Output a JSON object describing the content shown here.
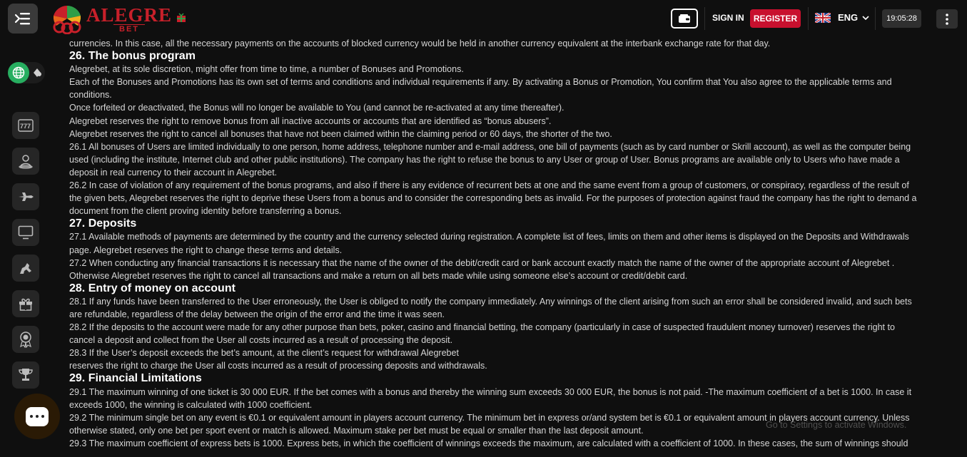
{
  "header": {
    "logo_word": "ALEGRE",
    "logo_sub": "BET",
    "sign_in_label": "SIGN IN",
    "register_label": "REGISTER",
    "language": "ENG",
    "time": "19:05:28"
  },
  "sidebar": {
    "icons": [
      "slots-icon",
      "live-dealer-icon",
      "aviator-icon",
      "tv-games-icon",
      "virtual-sports-icon",
      "gift-icon",
      "award-icon",
      "trophy-icon"
    ]
  },
  "content": {
    "lines": [
      {
        "type": "p",
        "text": "currencies. In this case, all the necessary payments on the accounts of blocked currency would be held in another currency equivalent at the interbank exchange rate for that day."
      },
      {
        "type": "h",
        "text": "26. The bonus program"
      },
      {
        "type": "p",
        "text": "Alegrebet, at its sole discretion, might offer from time to time, a number of Bonuses and Promotions."
      },
      {
        "type": "p",
        "text": "Each of the Bonuses and Promotions has its own set of terms and conditions and individual requirements if any. By activating a Bonus or Promotion, You confirm that You also agree to the applicable terms and"
      },
      {
        "type": "p",
        "text": "conditions."
      },
      {
        "type": "p",
        "text": "Once forfeited or deactivated, the Bonus will no longer be available to You (and cannot be re-activated at any time thereafter)."
      },
      {
        "type": "p",
        "text": "Alegrebet reserves the right to remove bonus from all inactive accounts or accounts that are identified as “bonus abusers”."
      },
      {
        "type": "p",
        "text": "Alegrebet reserves the right to cancel all bonuses that have not been claimed within the claiming period or 60 days, the shorter of the two."
      },
      {
        "type": "p",
        "text": "26.1 All bonuses of Users are limited individually to one person, home address, telephone number and e-mail address, one bill of payments (such as by card number or Skrill account), as well as the computer being"
      },
      {
        "type": "p",
        "text": "used (including the institute, Internet club and other public institutions). The company has the right to refuse the bonus to any User or group of User. Bonus programs are available only to Users who have made a"
      },
      {
        "type": "p",
        "text": "deposit in real currency to their account in Alegrebet."
      },
      {
        "type": "p",
        "text": "26.2 In case of violation of any requirement of the bonus programs, and also if there is any evidence of recurrent bets at one and the same event from a group of customers, or conspiracy, regardless of the result of"
      },
      {
        "type": "p",
        "text": "the given bets, Alegrebet reserves the right to deprive these Users from a bonus and to consider the corresponding bets as invalid. For the purposes of protection against fraud the company has the right to demand a"
      },
      {
        "type": "p",
        "text": "document from the client proving identity before transferring a bonus."
      },
      {
        "type": "h",
        "text": "27. Deposits"
      },
      {
        "type": "p",
        "text": "27.1 Available methods of payments are determined by the country and the currency selected during registration. A complete list of fees, limits on them and other items is displayed on the Deposits and Withdrawals"
      },
      {
        "type": "p",
        "text": "page. Alegrebet reserves the right to change these terms and details."
      },
      {
        "type": "p",
        "text": "27.2 When conducting any financial transactions it is necessary that the name of the owner of the debit/credit card or bank account exactly match the name of the owner of the appropriate account of Alegrebet ."
      },
      {
        "type": "p",
        "text": "Otherwise Alegrebet reserves the right to cancel all transactions and make a return on all bets made while using someone else’s account or credit/debit card."
      },
      {
        "type": "h",
        "text": "28. Entry of money on account"
      },
      {
        "type": "p",
        "text": "28.1 If any funds have been transferred to the User erroneously, the User is obliged to notify the company immediately. Any winnings of the client arising from such an error shall be considered invalid, and such bets"
      },
      {
        "type": "p",
        "text": "are refundable, regardless of the delay between the origin of the error and the time it was seen."
      },
      {
        "type": "p",
        "text": "28.2 If the deposits to the account were made for any other purpose than bets, poker, casino and financial betting, the company (particularly in case of suspected fraudulent money turnover) reserves the right to"
      },
      {
        "type": "p",
        "text": "cancel a deposit and collect from the User all costs incurred as a result of processing the deposit."
      },
      {
        "type": "p",
        "text": "28.3 If the User’s deposit exceeds the bet’s amount, at the client’s request for withdrawal Alegrebet"
      },
      {
        "type": "p",
        "text": "reserves the right to charge the User all costs incurred as a result of processing deposits and withdrawals."
      },
      {
        "type": "h",
        "text": "29. Financial Limitations"
      },
      {
        "type": "p",
        "text": "29.1 The maximum winning of one ticket is 30 000 EUR. If the bet comes with a bonus and thereby the winning sum exceeds 30 000 EUR, the bonus is not paid. -The maximum coefficient of a bet is 1000. In case it"
      },
      {
        "type": "p",
        "text": "exceeds 1000, the winning is calculated with 1000 coefficient."
      },
      {
        "type": "p",
        "text": "29.2 The minimum single bet on any event is €0.1 or equivalent amount in players account currency. The minimum bet in express or/and system bet is €0.1 or equivalent amount in players account currency. Unless"
      },
      {
        "type": "p",
        "text": "otherwise stated, only one bet per sport event or match is allowed. Maximum stake per bet must be equal or smaller than the last deposit amount."
      },
      {
        "type": "p",
        "text": "29.3 The maximum coefficient of express bets is 1000. Express bets, in which the coefficient of winnings exceeds the maximum, are calculated with a coefficient of 1000. In these cases, the sum of winnings should"
      }
    ],
    "watermark": "Go to Settings to activate Windows."
  },
  "colors": {
    "accent": "#c8102e",
    "toggle": "#27ae60",
    "background": "#0f0f0f"
  }
}
